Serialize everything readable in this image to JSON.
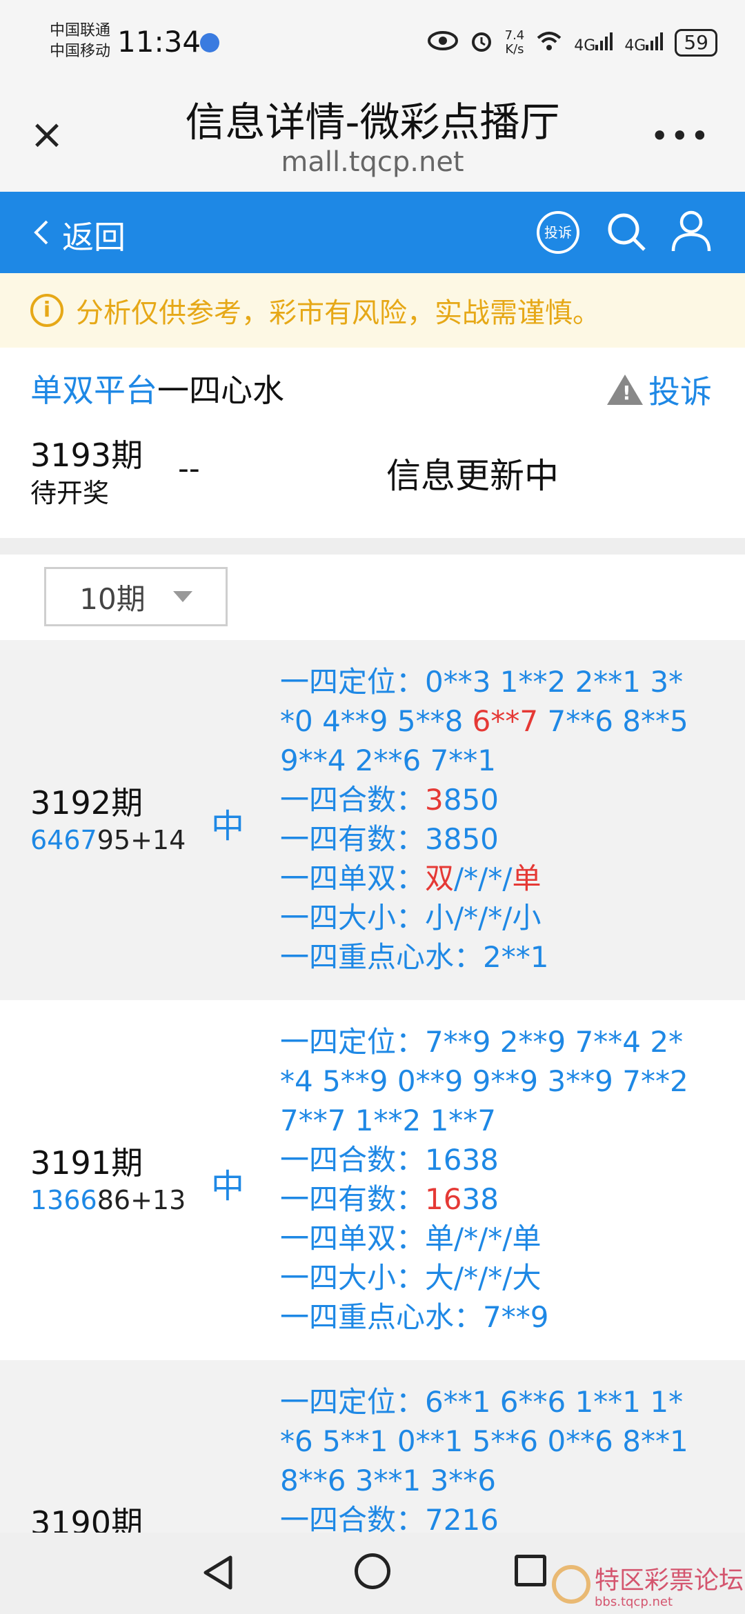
{
  "status_bar": {
    "carrier1": "中国联通",
    "carrier2": "中国移动",
    "time": "11:34",
    "speed_value": "7.4",
    "speed_unit": "K/s",
    "net1": "4G",
    "net2": "4G",
    "battery": "59"
  },
  "browser": {
    "title": "信息详情-微彩点播厅",
    "url": "mall.tqcp.net",
    "close_icon": "×",
    "more_icon": "•••"
  },
  "nav": {
    "back_label": "返回",
    "report_label": "投诉",
    "accent": "#1e88e5"
  },
  "notice": {
    "text": "分析仅供参考，彩市有风险，实战需谨慎。",
    "color": "#e6a817"
  },
  "header": {
    "platform": "单双平台",
    "topic": "一四心水",
    "complain_label": "投诉",
    "current_period": "3193期",
    "current_status": "待开奖",
    "current_dash": "--",
    "update_text": "信息更新中"
  },
  "filter": {
    "selected": "10期"
  },
  "rows": [
    {
      "period": "3192期",
      "draw_head": "6467",
      "draw_tail": "95+14",
      "hit": "中",
      "l1a": "一四定位：0**3 1**2 2**1 3*",
      "l1b": "*0 4**9 5**8 ",
      "l1red": "6**7",
      "l1c": " 7**6 8**5",
      "l1d": "9**4 2**6 7**1",
      "hs_label": "一四合数：",
      "hs_red": "3",
      "hs_rest": "850",
      "ys": "一四有数：3850",
      "ds_label": "一四单双：",
      "ds_red1": "双",
      "ds_mid": "/*/*/",
      "ds_red2": "单",
      "dx": "一四大小：小/*/*/小",
      "zd": "一四重点心水：2**1"
    },
    {
      "period": "3191期",
      "draw_head": "1366",
      "draw_tail": "86+13",
      "hit": "中",
      "l1a": "一四定位：7**9 2**9 7**4 2*",
      "l1b": "*4 5**9 0**9 9**9 3**9 7**2",
      "l1c": "7**7 1**2 1**7",
      "hs": "一四合数：1638",
      "ys_label": "一四有数：",
      "ys_red": "16",
      "ys_rest": "38",
      "ds": "一四单双：单/*/*/单",
      "dx": "一四大小：大/*/*/大",
      "zd": "一四重点心水：7**9"
    },
    {
      "period": "3190期",
      "l1a": "一四定位：6**1 6**6 1**1 1*",
      "l1b": "*6 5**1 0**1 5**6 0**6 8**1",
      "l1c": "8**6 3**1 3**6",
      "hs": "一四合数：7216"
    }
  ],
  "watermark": {
    "text": "特区彩票论坛",
    "sub": "bbs.tqcp.net"
  }
}
